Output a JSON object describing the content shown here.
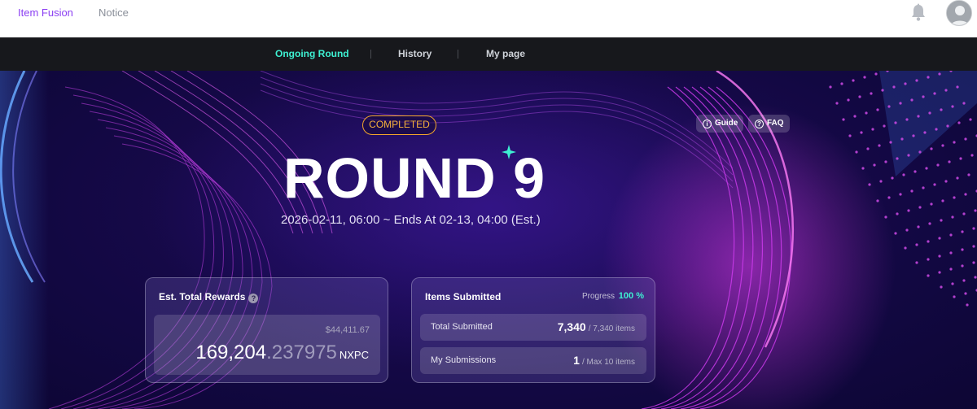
{
  "topbar": {
    "tabs": [
      "Item Fusion",
      "Notice"
    ],
    "bell_icon": "bell-icon",
    "avatar_icon": "user-avatar-icon"
  },
  "subnav": {
    "items": [
      "Ongoing Round",
      "History",
      "My page"
    ],
    "active_color": "#3ef0d2"
  },
  "hero": {
    "status": "COMPLETED",
    "title": "ROUND 9",
    "dates": "2026-02-11, 06:00 ~ Ends At 02-13, 04:00 (Est.)",
    "guide_label": "Guide",
    "faq_label": "FAQ"
  },
  "rewards": {
    "title": "Est. Total Rewards",
    "usd": "$44,411.67",
    "amount_int": "169,204",
    "amount_dec": ".237975",
    "unit": "NXPC"
  },
  "items": {
    "title": "Items Submitted",
    "progress_label": "Progress",
    "progress_value": "100 %",
    "total_label": "Total Submitted",
    "total_value": "7,340",
    "total_of": "/ 7,340 items",
    "mine_label": "My Submissions",
    "mine_value": "1",
    "mine_of": "/ Max 10 items"
  },
  "colors": {
    "accent_purple": "#8b3ff2",
    "accent_teal": "#3ef0d2",
    "badge_orange": "#f2a52b"
  }
}
